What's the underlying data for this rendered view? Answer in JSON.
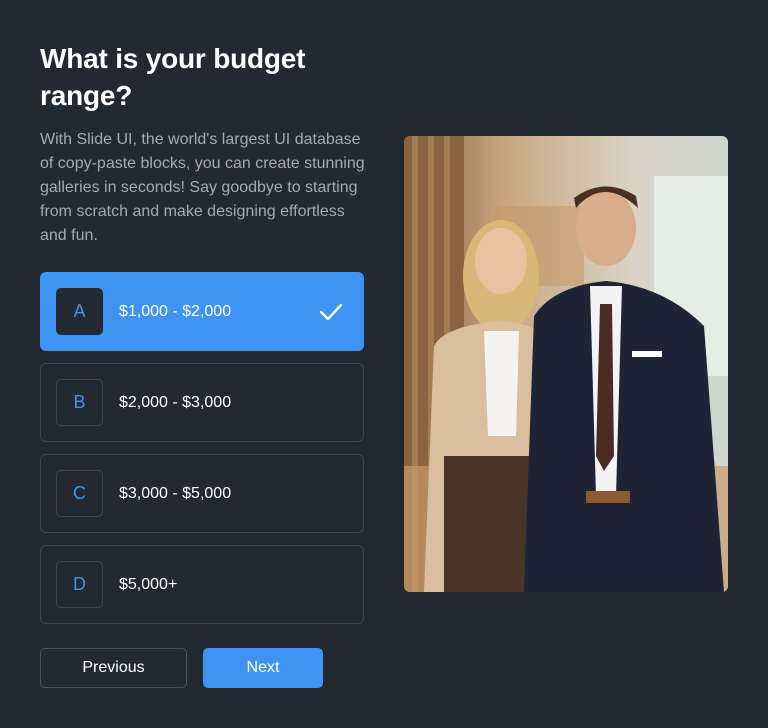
{
  "question": {
    "title": "What is your budget range?",
    "description": "With Slide UI, the world's largest UI database of copy-paste blocks, you can create stunning galleries in seconds! Say goodbye to starting from scratch and make designing effortless and fun."
  },
  "options": [
    {
      "letter": "A",
      "label": "$1,000 - $2,000",
      "selected": true
    },
    {
      "letter": "B",
      "label": "$2,000 - $3,000",
      "selected": false
    },
    {
      "letter": "C",
      "label": "$3,000 - $5,000",
      "selected": false
    },
    {
      "letter": "D",
      "label": "$5,000+",
      "selected": false
    }
  ],
  "buttons": {
    "previous": "Previous",
    "next": "Next"
  },
  "icons": {
    "selected_check": "check-icon"
  },
  "colors": {
    "background": "#222931",
    "accent": "#3f94f3",
    "border": "#3d4550",
    "muted_text": "#a3abb5"
  }
}
